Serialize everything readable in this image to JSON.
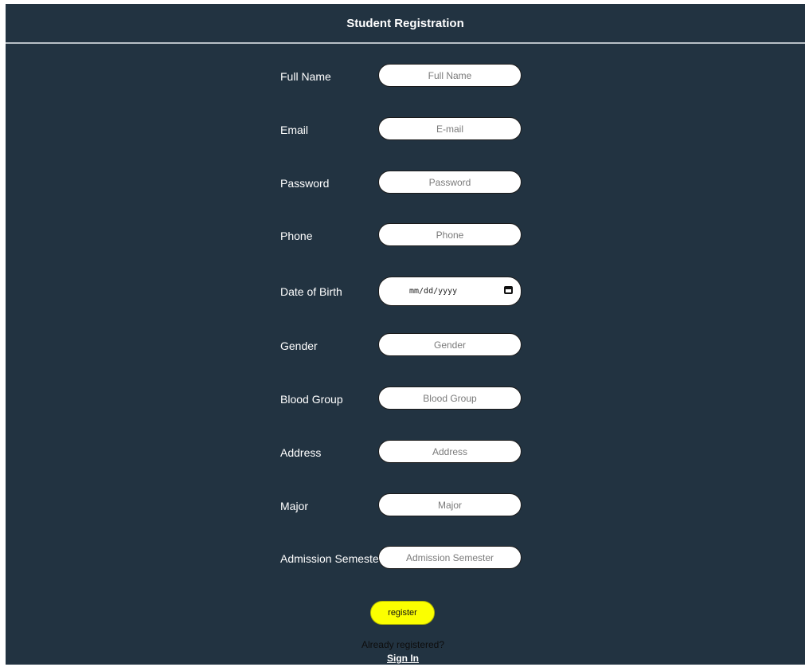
{
  "header": {
    "title": "Student Registration"
  },
  "form": {
    "fields": [
      {
        "label": "Full Name",
        "placeholder": "Full Name"
      },
      {
        "label": "Email",
        "placeholder": "E-mail"
      },
      {
        "label": "Password",
        "placeholder": "Password"
      },
      {
        "label": "Phone",
        "placeholder": "Phone"
      },
      {
        "label": "Date of Birth",
        "placeholder": "mm/dd/yyyy"
      },
      {
        "label": "Gender",
        "placeholder": "Gender"
      },
      {
        "label": "Blood Group",
        "placeholder": "Blood Group"
      },
      {
        "label": "Address",
        "placeholder": "Address"
      },
      {
        "label": "Major",
        "placeholder": "Major"
      },
      {
        "label": "Admission Semester",
        "placeholder": "Admission Semester"
      }
    ],
    "date_icon": "calendar-icon",
    "register_label": "register"
  },
  "footer": {
    "already_text": "Already registered?",
    "signin_label": "Sign In"
  },
  "colors": {
    "background": "#223341",
    "register_button": "#fbff00"
  }
}
